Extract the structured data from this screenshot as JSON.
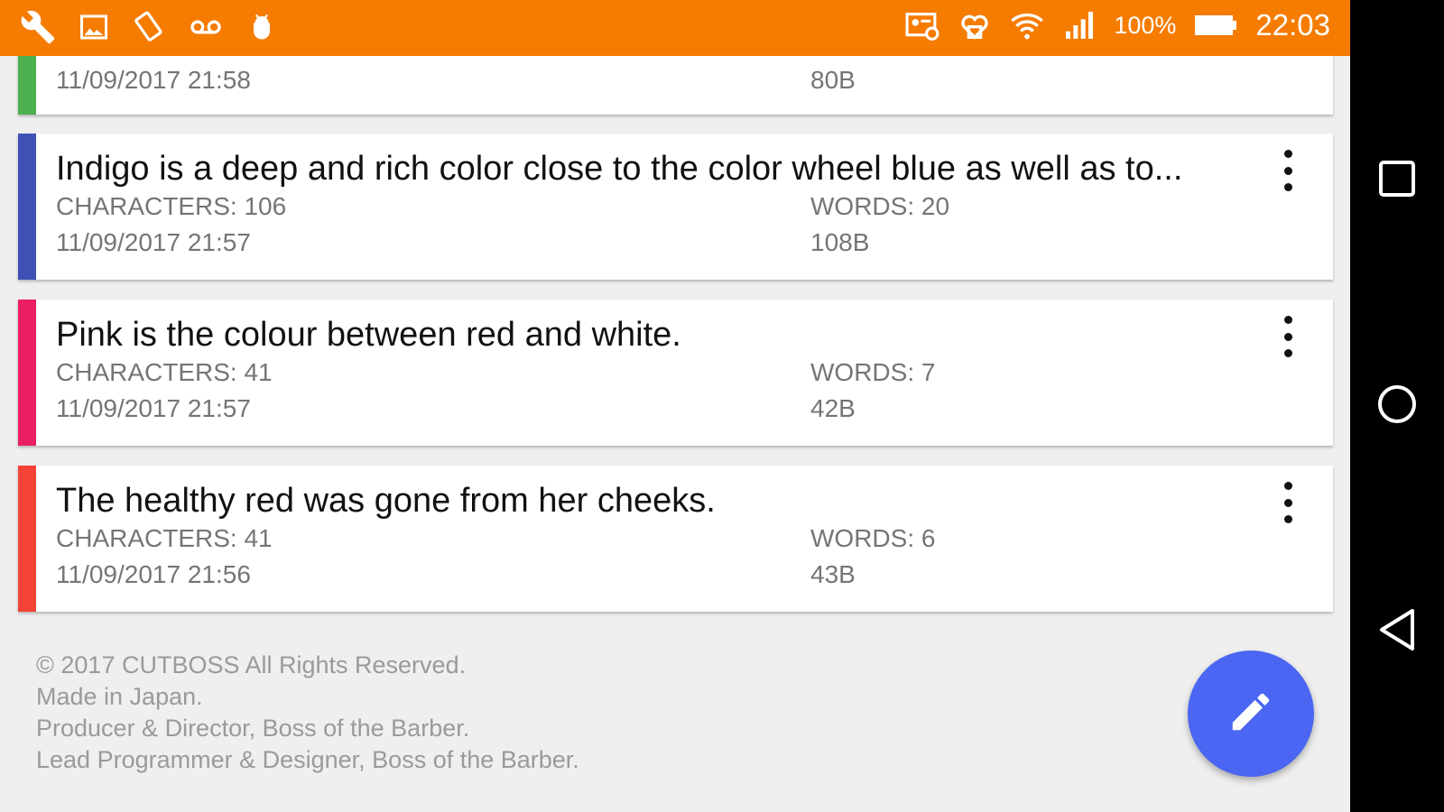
{
  "status_bar": {
    "left_icons": [
      "wrench-icon",
      "image-icon",
      "screen-rotation-icon",
      "voicemail-icon",
      "android-icon"
    ],
    "right_icons": [
      "id-card-icon",
      "heart-badge-icon",
      "wifi-icon",
      "signal-icon"
    ],
    "battery_percent": "100%",
    "time": "22:03",
    "bar_color": "#f57c00"
  },
  "notes": [
    {
      "title": "",
      "characters": "",
      "words": "",
      "date": "11/09/2017 21:58",
      "size": "80B",
      "color": "#4caf50"
    },
    {
      "title": "Indigo is a deep and rich color close to the color wheel blue as well as to...",
      "characters": "CHARACTERS: 106",
      "words": "WORDS: 20",
      "date": "11/09/2017 21:57",
      "size": "108B",
      "color": "#3f51b5"
    },
    {
      "title": "Pink is the colour between red and white.",
      "characters": "CHARACTERS: 41",
      "words": "WORDS: 7",
      "date": "11/09/2017 21:57",
      "size": "42B",
      "color": "#e91e63"
    },
    {
      "title": "The healthy red was gone from her cheeks.",
      "characters": "CHARACTERS: 41",
      "words": "WORDS: 6",
      "date": "11/09/2017 21:56",
      "size": "43B",
      "color": "#f44336"
    }
  ],
  "footer": {
    "line1": "© 2017 CUTBOSS All Rights Reserved.",
    "line2": "Made in Japan.",
    "line3": "Producer & Director, Boss of the Barber.",
    "line4": "Lead Programmer & Designer, Boss of the Barber."
  },
  "fab": {
    "icon": "pencil-icon",
    "color": "#4a66f2"
  },
  "nav": {
    "icons": [
      "recents-icon",
      "home-icon",
      "back-icon"
    ]
  }
}
